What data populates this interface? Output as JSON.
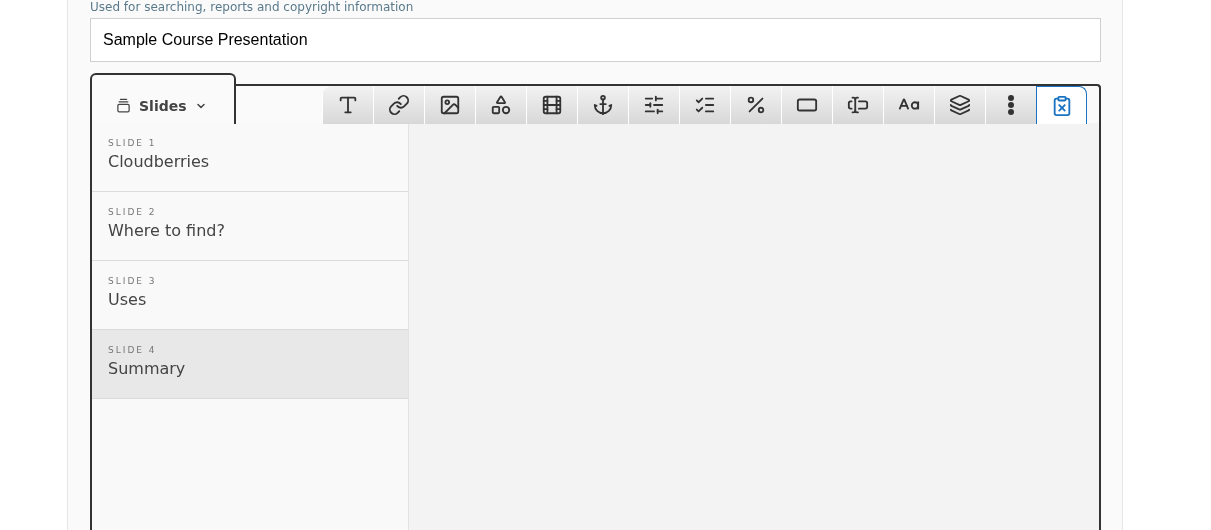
{
  "field_description": "Used for searching, reports and copyright information",
  "title_field": {
    "value": "Sample Course Presentation"
  },
  "slides_tab": {
    "label": "Slides"
  },
  "toolbar": [
    {
      "kind": "text",
      "selected": false
    },
    {
      "kind": "link",
      "selected": false
    },
    {
      "kind": "image",
      "selected": false
    },
    {
      "kind": "shape",
      "selected": false
    },
    {
      "kind": "video",
      "selected": false
    },
    {
      "kind": "anchor",
      "selected": false
    },
    {
      "kind": "toggles",
      "selected": false
    },
    {
      "kind": "checklist",
      "selected": false
    },
    {
      "kind": "fraction",
      "selected": false
    },
    {
      "kind": "frame",
      "selected": false
    },
    {
      "kind": "textbox",
      "selected": false
    },
    {
      "kind": "letters",
      "selected": false
    },
    {
      "kind": "cards",
      "selected": false
    },
    {
      "kind": "more",
      "selected": false
    },
    {
      "kind": "paste",
      "selected": true
    }
  ],
  "slides": [
    {
      "number": "SLIDE 1",
      "title": "Cloudberries",
      "selected": false
    },
    {
      "number": "SLIDE 2",
      "title": "Where to find?",
      "selected": false
    },
    {
      "number": "SLIDE 3",
      "title": "Uses",
      "selected": false
    },
    {
      "number": "SLIDE 4",
      "title": "Summary",
      "selected": true
    }
  ]
}
